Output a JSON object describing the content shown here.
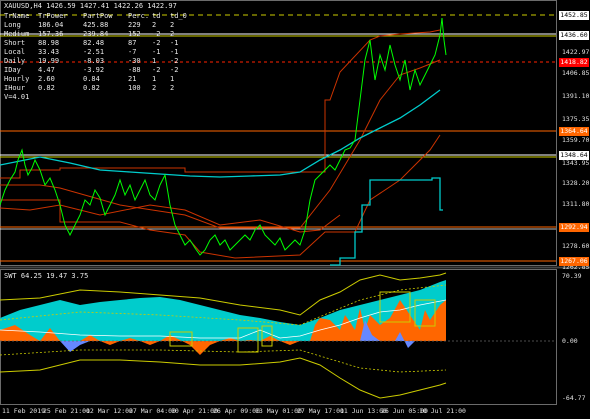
{
  "header": {
    "symbol_line": "XAUUSD,H4  1426.59 1427.41 1422.26 1422.97"
  },
  "info_table": {
    "columns": [
      "TrName",
      "TrPower",
      "PartPow",
      "Perc.",
      "td",
      "td_0"
    ],
    "rows": [
      [
        "Long",
        "186.04",
        "425.88",
        "229",
        "2",
        "2"
      ],
      [
        "Medium",
        "157.36",
        "239.84",
        "152",
        "-2",
        "2"
      ],
      [
        "Short",
        "88.98",
        "82.48",
        "87",
        "-2",
        "-1"
      ],
      [
        "Local",
        "33.43",
        "-2.51",
        "-7",
        "-1",
        "-1"
      ],
      [
        "Daily",
        "19.99",
        "-8.03",
        "-30",
        "1",
        "-2"
      ],
      [
        "IDay",
        "4.47",
        "-3.92",
        "-88",
        "-2",
        "-2"
      ],
      [
        "Hourly",
        "2.60",
        "0.84",
        "21",
        "1",
        "1"
      ],
      [
        "IHour",
        "0.82",
        "0.82",
        "100",
        "2",
        "2"
      ]
    ],
    "version": "V=4.01"
  },
  "price_axis": {
    "ticks": [
      "1422.97",
      "1406.85",
      "1391.10",
      "1375.35",
      "1359.70",
      "1343.95",
      "1328.20",
      "1311.80",
      "1296.00",
      "1278.60",
      "1262.85"
    ],
    "tags": [
      {
        "label": "1452.85",
        "bg": "#ffffff",
        "fg": "#000000"
      },
      {
        "label": "1436.60",
        "bg": "#ffffff",
        "fg": "#000000"
      },
      {
        "label": "1418.82",
        "bg": "#ff0000",
        "fg": "#ffffff"
      },
      {
        "label": "1364.64",
        "bg": "#ff6600",
        "fg": "#ffffff"
      },
      {
        "label": "1348.64",
        "bg": "#ffffff",
        "fg": "#000000"
      },
      {
        "label": "1292.94",
        "bg": "#ff6600",
        "fg": "#ffffff"
      },
      {
        "label": "1267.06",
        "bg": "#ff6600",
        "fg": "#ffffff"
      }
    ]
  },
  "indicator": {
    "title": "SWT 64.25 19.47 3.75",
    "ticks": [
      "70.39",
      "0.00",
      "-64.77"
    ]
  },
  "time_axis": {
    "ticks": [
      "11 Feb 2019",
      "25 Feb 21:00",
      "12 Mar 12:00",
      "27 Mar 04:00",
      "10 Apr 21:00",
      "26 Apr 09:00",
      "13 May 01:00",
      "27 May 17:00",
      "11 Jun 13:00",
      "26 Jun 05:00",
      "10 Jul 21:00"
    ]
  },
  "colors": {
    "price": "#00ff00",
    "ma_slow": "#00cccc",
    "channel": "#cc3300",
    "level_white": "#ffffff",
    "level_yellow": "#cccc00",
    "hist_orange": "#ff6600",
    "hist_cyan": "#00cccc",
    "hist_blue": "#6688ff"
  }
}
